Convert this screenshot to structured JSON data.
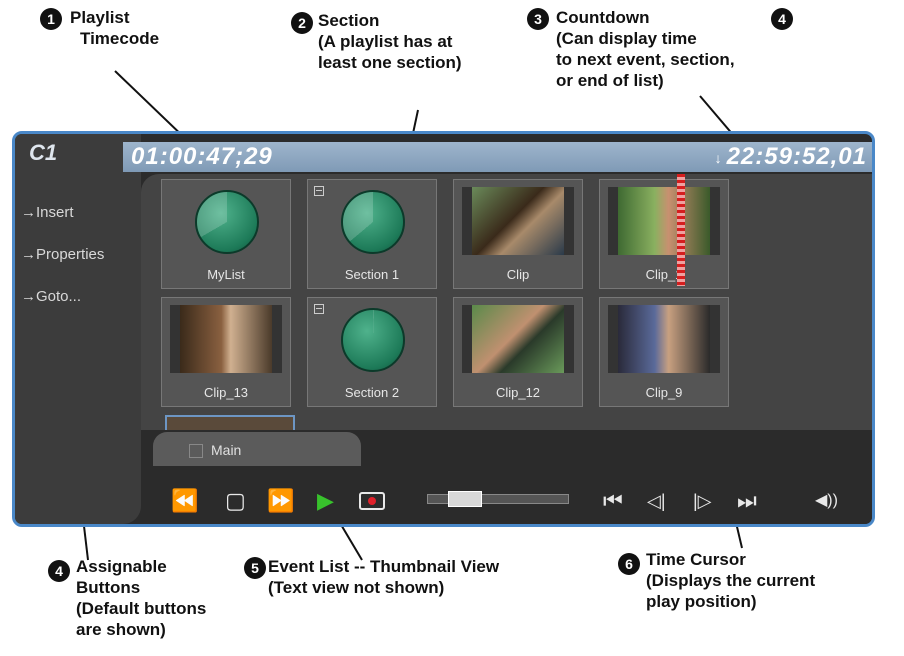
{
  "callouts": {
    "c1": {
      "num": "1",
      "lines": [
        "Playlist",
        "Timecode"
      ]
    },
    "c2": {
      "num": "2",
      "lines": [
        "Section",
        "(A playlist has at",
        "least one section)"
      ]
    },
    "c3": {
      "num": "3",
      "lines": [
        "Countdown",
        "(Can display time",
        "to next event, section,",
        "or end of list)"
      ]
    },
    "c4top": {
      "num": "4"
    },
    "c4": {
      "num": "4",
      "lines": [
        "Assignable",
        "Buttons",
        "(Default buttons",
        "are shown)"
      ]
    },
    "c5": {
      "num": "5",
      "lines": [
        "Event List -- Thumbnail View",
        "(Text view not shown)"
      ]
    },
    "c6": {
      "num": "6",
      "lines": [
        "Time Cursor",
        "(Displays the current",
        "play position)"
      ]
    }
  },
  "app": {
    "channel": "C1",
    "playlist_timecode": "01:00:47;29",
    "countdown_timecode": "22:59:52,01",
    "countdown_arrow": "↓",
    "side_buttons": [
      "→Insert",
      "→Properties",
      "→Goto..."
    ],
    "tiles": [
      {
        "label": "MyList",
        "kind": "playlist"
      },
      {
        "label": "Section 1",
        "kind": "section"
      },
      {
        "label": "Clip",
        "kind": "clip"
      },
      {
        "label": "Clip_1",
        "kind": "clip"
      },
      {
        "label": "Clip_13",
        "kind": "clip"
      },
      {
        "label": "Section 2",
        "kind": "section"
      },
      {
        "label": "Clip_12",
        "kind": "clip"
      },
      {
        "label": "Clip_9",
        "kind": "clip"
      }
    ],
    "tab_label": "Main",
    "transport": {
      "rewind": "⏪",
      "stop": "▢",
      "fast_forward": "⏩",
      "play": "▶",
      "first": "⏮",
      "step_back": "◁|",
      "step_forward": "|▷",
      "last": "⏭",
      "volume": "◀))"
    },
    "colors": {
      "accent_border": "#4a88c8",
      "timecode_bar": "#8fa8c2",
      "play": "#38c22c",
      "record": "#e0202a",
      "cursor": "#d61e1e"
    }
  }
}
